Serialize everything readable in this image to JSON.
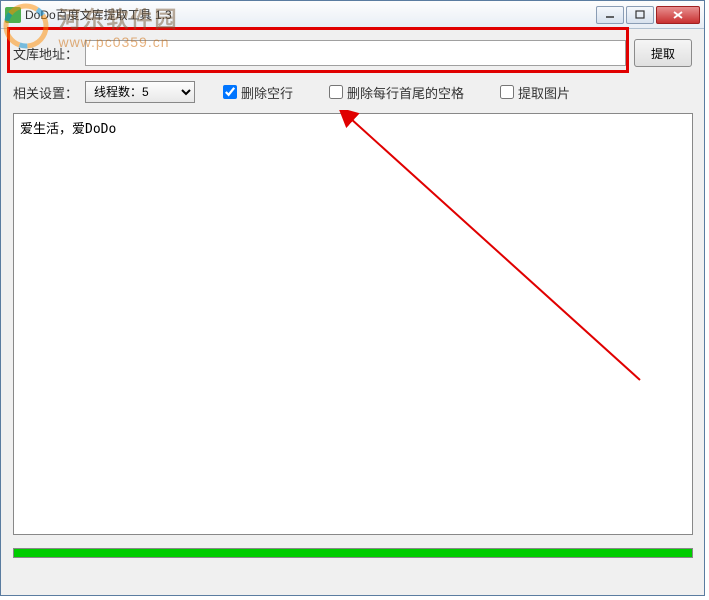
{
  "window": {
    "title": "DoDo百度文库提取工具  1.3"
  },
  "url_row": {
    "label": "文库地址：",
    "value": "",
    "button": "提取"
  },
  "settings": {
    "label": "相关设置：",
    "thread": "线程数：5",
    "cb1_label": "删除空行",
    "cb1_checked": true,
    "cb2_label": "删除每行首尾的空格",
    "cb2_checked": false,
    "cb3_label": "提取图片",
    "cb3_checked": false
  },
  "content": "爱生活，爱DoDo",
  "watermark": {
    "title": "河东软件园",
    "url": "www.pc0359.cn"
  }
}
